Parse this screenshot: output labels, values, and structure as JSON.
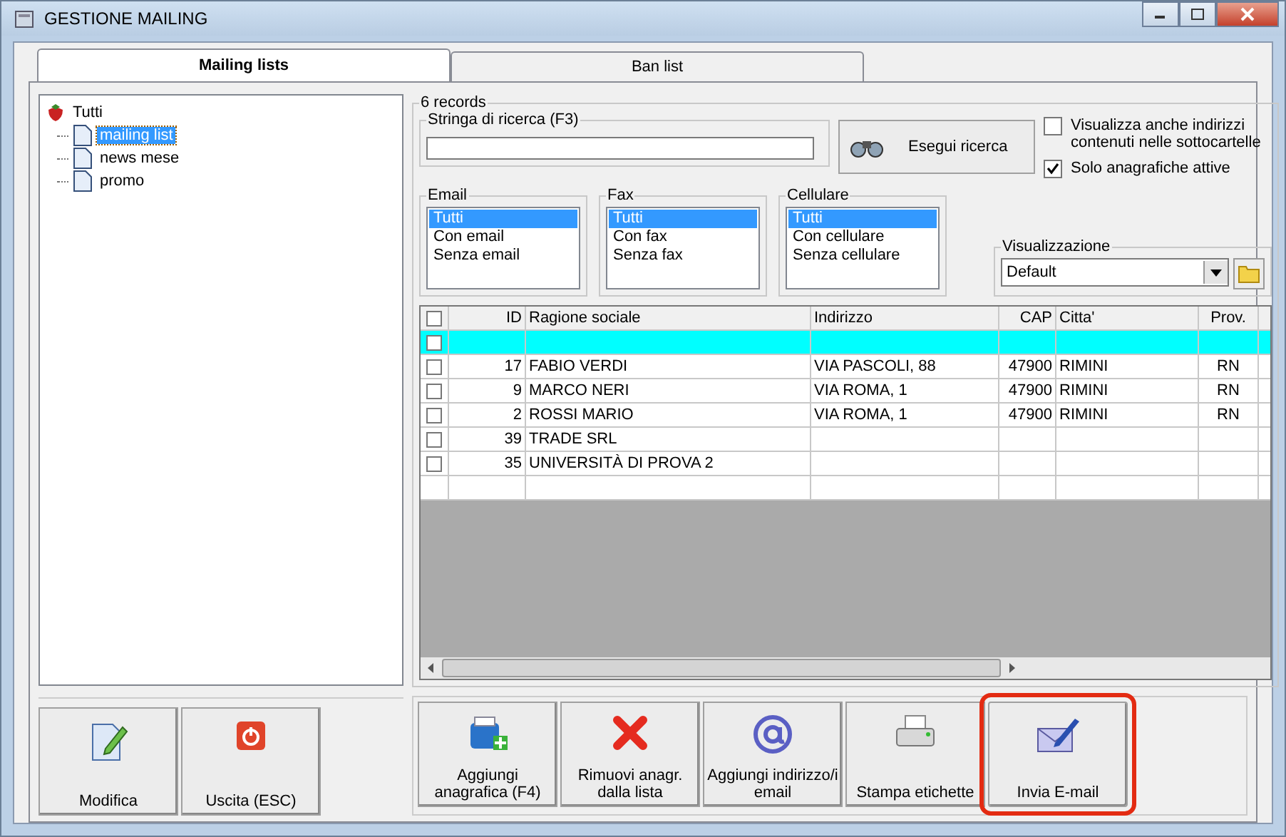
{
  "window": {
    "title": "GESTIONE MAILING"
  },
  "tabs": [
    {
      "label": "Mailing lists",
      "selected": true
    },
    {
      "label": "Ban list",
      "selected": false
    }
  ],
  "tree": {
    "label": "Tutti",
    "children": [
      {
        "label": "mailing list",
        "selected": true
      },
      {
        "label": "news mese",
        "selected": false
      },
      {
        "label": "promo",
        "selected": false
      }
    ]
  },
  "records_label": "6 records",
  "search": {
    "label": "Stringa di ricerca (F3)",
    "button": "Esegui ricerca"
  },
  "options": [
    {
      "label": "Visualizza anche indirizzi contenuti nelle sottocartelle",
      "checked": false
    },
    {
      "label": "Solo anagrafiche attive",
      "checked": true
    }
  ],
  "filters": [
    {
      "title": "Email",
      "items": [
        {
          "label": "Tutti",
          "selected": true
        },
        {
          "label": "Con email",
          "selected": false
        },
        {
          "label": "Senza email",
          "selected": false
        }
      ]
    },
    {
      "title": "Fax",
      "items": [
        {
          "label": "Tutti",
          "selected": true
        },
        {
          "label": "Con fax",
          "selected": false
        },
        {
          "label": "Senza fax",
          "selected": false
        }
      ]
    },
    {
      "title": "Cellulare",
      "items": [
        {
          "label": "Tutti",
          "selected": true
        },
        {
          "label": "Con cellulare",
          "selected": false
        },
        {
          "label": "Senza cellulare",
          "selected": false
        }
      ]
    }
  ],
  "view": {
    "label": "Visualizzazione",
    "value": "Default"
  },
  "table": {
    "header_checked": false,
    "columns": [
      "ID",
      "Ragione sociale",
      "Indirizzo",
      "CAP",
      "Citta'",
      "Prov."
    ],
    "rows": [
      {
        "checked": false,
        "selected": true
      },
      {
        "checked": false,
        "selected": false,
        "cells": [
          "17",
          "FABIO VERDI",
          "VIA PASCOLI, 88",
          "47900",
          "RIMINI",
          "RN"
        ]
      },
      {
        "checked": false,
        "selected": false,
        "cells": [
          "9",
          "MARCO NERI",
          "VIA ROMA, 1",
          "47900",
          "RIMINI",
          "RN"
        ]
      },
      {
        "checked": false,
        "selected": false,
        "cells": [
          "2",
          "ROSSI MARIO",
          "VIA ROMA, 1",
          "47900",
          "RIMINI",
          "RN"
        ]
      },
      {
        "checked": false,
        "selected": false,
        "cells": [
          "39",
          "TRADE SRL"
        ]
      },
      {
        "checked": false,
        "selected": false,
        "cells": [
          "35",
          "UNIVERSITÀ DI PROVA 2"
        ]
      }
    ]
  },
  "left_buttons": [
    {
      "label": "Modifica"
    },
    {
      "label": "Uscita (ESC)"
    }
  ],
  "action_buttons": [
    {
      "label": "Aggiungi anagrafica (F4)",
      "highlighted": false
    },
    {
      "label": "Rimuovi anagr. dalla lista",
      "highlighted": false
    },
    {
      "label": "Aggiungi indirizzo/i email",
      "highlighted": false
    },
    {
      "label": "Stampa etichette",
      "highlighted": false
    },
    {
      "label": "Invia E-mail",
      "highlighted": true
    }
  ]
}
